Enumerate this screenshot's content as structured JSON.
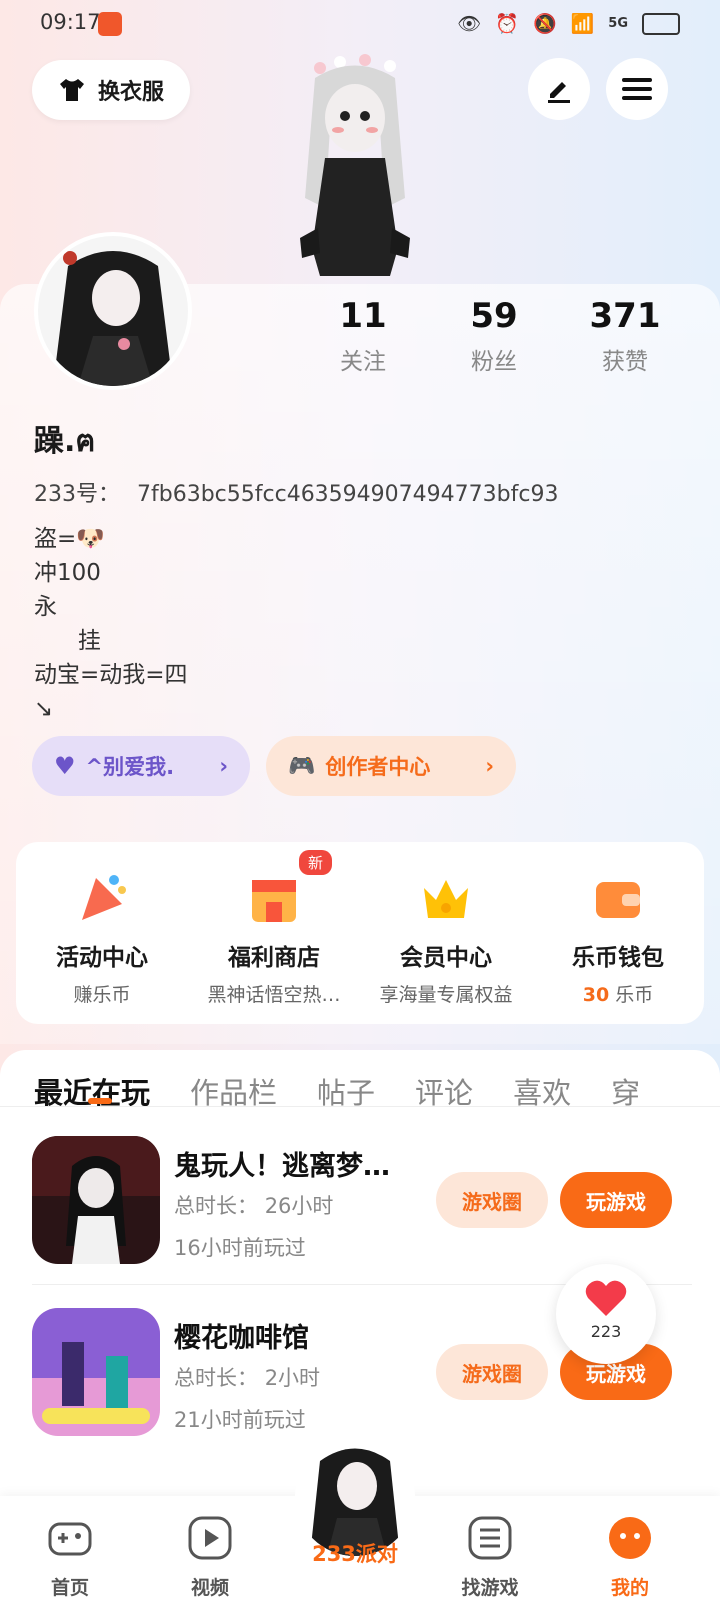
{
  "status": {
    "time": "09:17",
    "net": "5G"
  },
  "header": {
    "outfit_label": "换衣服"
  },
  "stats": [
    {
      "value": "11",
      "label": "关注"
    },
    {
      "value": "59",
      "label": "粉丝"
    },
    {
      "value": "371",
      "label": "获赞"
    }
  ],
  "profile": {
    "name": "躁.ฅ",
    "id_label": "233号：",
    "id_value": "7fb63bc55fcc463594907494773bfc93",
    "bio": "盗=🐶\n冲100\n永\n      挂\n动宝=动我=四\n↘"
  },
  "chips": {
    "love": "^别爱我.",
    "creator": "创作者中心"
  },
  "services": [
    {
      "title": "活动中心",
      "sub": "赚乐币",
      "badge": ""
    },
    {
      "title": "福利商店",
      "sub": "黑神话悟空热…",
      "badge": "新"
    },
    {
      "title": "会员中心",
      "sub": "享海量专属权益",
      "badge": ""
    },
    {
      "title": "乐币钱包",
      "sub_num": "30",
      "sub": "乐币",
      "badge": ""
    }
  ],
  "tabs": [
    "最近在玩",
    "作品栏",
    "帖子",
    "评论",
    "喜欢",
    "穿"
  ],
  "games": [
    {
      "name": "鬼玩人！逃离梦…",
      "duration_label": "总时长：",
      "duration": "26小时",
      "last": "16小时前玩过",
      "circle_btn": "游戏圈",
      "play_btn": "玩游戏"
    },
    {
      "name": "樱花咖啡馆",
      "duration_label": "总时长：",
      "duration": "2小时",
      "last": "21小时前玩过",
      "circle_btn": "游戏圈",
      "play_btn": "玩游戏"
    }
  ],
  "float_like": {
    "count": "223"
  },
  "nav": [
    {
      "label": "首页"
    },
    {
      "label": "视频"
    },
    {
      "label": "233派对"
    },
    {
      "label": "找游戏"
    },
    {
      "label": "我的"
    }
  ],
  "colors": {
    "accent": "#f96a16",
    "purple_chip": "#e6def8",
    "orange_chip": "#fde6d8"
  }
}
